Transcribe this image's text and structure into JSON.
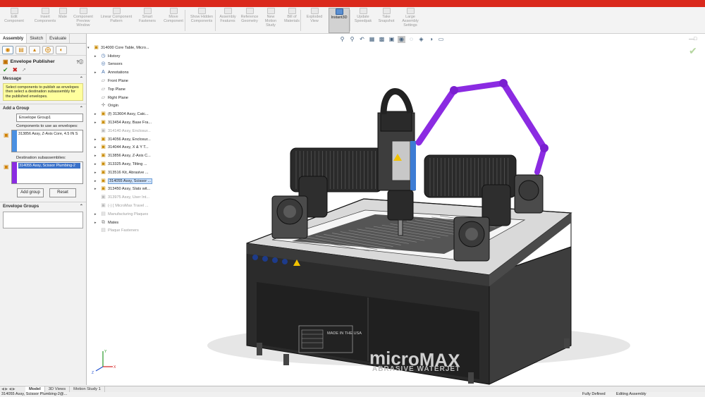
{
  "ribbon": {
    "buttons": [
      {
        "icon": "edit-component-icon",
        "label": "Edit Component"
      },
      {
        "icon": "insert-components-icon",
        "label": "Insert Components"
      },
      {
        "icon": "mate-icon",
        "label": "Mate"
      },
      {
        "icon": "component-preview-icon",
        "label": "Component Preview Window"
      },
      {
        "icon": "linear-pattern-icon",
        "label": "Linear Component Pattern"
      },
      {
        "icon": "smart-fasteners-icon",
        "label": "Smart Fasteners"
      },
      {
        "icon": "move-component-icon",
        "label": "Move Component"
      },
      {
        "icon": "show-hidden-icon",
        "label": "Show Hidden Components"
      },
      {
        "icon": "assembly-features-icon",
        "label": "Assembly Features"
      },
      {
        "icon": "reference-geometry-icon",
        "label": "Reference Geometry"
      },
      {
        "icon": "new-motion-study-icon",
        "label": "New Motion Study"
      },
      {
        "icon": "bill-of-materials-icon",
        "label": "Bill of Materials"
      },
      {
        "icon": "exploded-view-icon",
        "label": "Exploded View"
      },
      {
        "icon": "instant3d-icon",
        "label": "Instant3D"
      },
      {
        "icon": "update-speedpak-icon",
        "label": "Update Speedpak"
      },
      {
        "icon": "take-snapshot-icon",
        "label": "Take Snapshot"
      },
      {
        "icon": "large-assembly-settings-icon",
        "label": "Large Assembly Settings"
      }
    ]
  },
  "left_panel": {
    "tabs": [
      "Assembly",
      "Sketch",
      "Evaluate"
    ],
    "title": "Envelope Publisher",
    "ok_symbol": "✔",
    "cancel_symbol": "✖",
    "message_section": "Message",
    "message": "Select components to publish as envelopes then select a destination subassembly for the published envelopes.",
    "group_section": "Add a Group",
    "group_name": "Envelope Group1",
    "components_label": "Components to use as envelopes:",
    "components_value": "313856 Assy, Z-Axis Core, 4.5 IN S",
    "destination_label": "Destination subassemblies:",
    "destination_value": "314055 Assy, Scissor Plumbing-2",
    "add_group": "Add group",
    "reset": "Reset",
    "envelope_groups_section": "Envelope Groups",
    "colors": {
      "components_bar": "#4a90e2",
      "destination_bar": "#8a2be2"
    }
  },
  "tree": {
    "root": "314000 Core Table, Micro...",
    "items": [
      {
        "label": "History",
        "icon": "history-icon",
        "expand": "▸",
        "dim": false,
        "selected": false
      },
      {
        "label": "Sensors",
        "icon": "sensors-icon",
        "expand": "",
        "dim": false,
        "selected": false
      },
      {
        "label": "Annotations",
        "icon": "annotations-icon",
        "expand": "▸",
        "dim": false,
        "selected": false
      },
      {
        "label": "Front Plane",
        "icon": "plane-icon",
        "expand": "",
        "dim": false,
        "selected": false
      },
      {
        "label": "Top Plane",
        "icon": "plane-icon",
        "expand": "",
        "dim": false,
        "selected": false
      },
      {
        "label": "Right Plane",
        "icon": "plane-icon",
        "expand": "",
        "dim": false,
        "selected": false
      },
      {
        "label": "Origin",
        "icon": "origin-icon",
        "expand": "",
        "dim": false,
        "selected": false
      },
      {
        "label": "(f) 313604 Assy, Catc...",
        "icon": "assembly-icon",
        "expand": "▸",
        "dim": false,
        "selected": false
      },
      {
        "label": "313454 Assy, Base Fra...",
        "icon": "assembly-icon",
        "expand": "▸",
        "dim": false,
        "selected": false
      },
      {
        "label": "314140 Assy, Enclosur...",
        "icon": "assembly-icon",
        "expand": "",
        "dim": true,
        "selected": false
      },
      {
        "label": "314056 Assy, Enclosur...",
        "icon": "assembly-icon",
        "expand": "▸",
        "dim": false,
        "selected": false
      },
      {
        "label": "314044 Assy, X & Y T...",
        "icon": "assembly-icon",
        "expand": "▸",
        "dim": false,
        "selected": false
      },
      {
        "label": "313856 Assy, Z-Axis C...",
        "icon": "assembly-icon",
        "expand": "▸",
        "dim": false,
        "selected": false
      },
      {
        "label": "313325 Assy, Tilting ...",
        "icon": "assembly-icon",
        "expand": "▸",
        "dim": false,
        "selected": false
      },
      {
        "label": "313516 Kit, Abrasive ...",
        "icon": "assembly-icon",
        "expand": "▸",
        "dim": false,
        "selected": false
      },
      {
        "label": "314055 Assy, Scissor ...",
        "icon": "assembly-icon",
        "expand": "▸",
        "dim": false,
        "selected": true
      },
      {
        "label": "313450 Assy, Slats wit...",
        "icon": "assembly-icon",
        "expand": "▸",
        "dim": false,
        "selected": false
      },
      {
        "label": "313975 Assy, User Int...",
        "icon": "assembly-icon",
        "expand": "",
        "dim": true,
        "selected": false
      },
      {
        "label": "(-) [ MicroMax Travel ...",
        "icon": "assembly-icon",
        "expand": "",
        "dim": true,
        "selected": false
      },
      {
        "label": "Manufacturing Plaques",
        "icon": "folder-icon",
        "expand": "▸",
        "dim": true,
        "selected": false
      },
      {
        "label": "Mates",
        "icon": "mates-icon",
        "expand": "▸",
        "dim": false,
        "selected": false
      },
      {
        "label": "Plaque Fasteners",
        "icon": "folder-icon",
        "expand": "",
        "dim": true,
        "selected": false
      }
    ]
  },
  "viewport": {
    "brand": "microMAX",
    "brand_sub": "ABRASIVE WATERJET",
    "plaque": "MADE IN THE USA",
    "accept_symbol": "✔",
    "axis_labels": [
      "X",
      "Y",
      "Z"
    ]
  },
  "bottom_tabs": [
    "Model",
    "3D Views",
    "Motion Study 1"
  ],
  "status": {
    "selection": "314055 Assy, Scissor Plumbing-2@...",
    "state": "Fully Defined",
    "mode": "Editing Assembly"
  }
}
